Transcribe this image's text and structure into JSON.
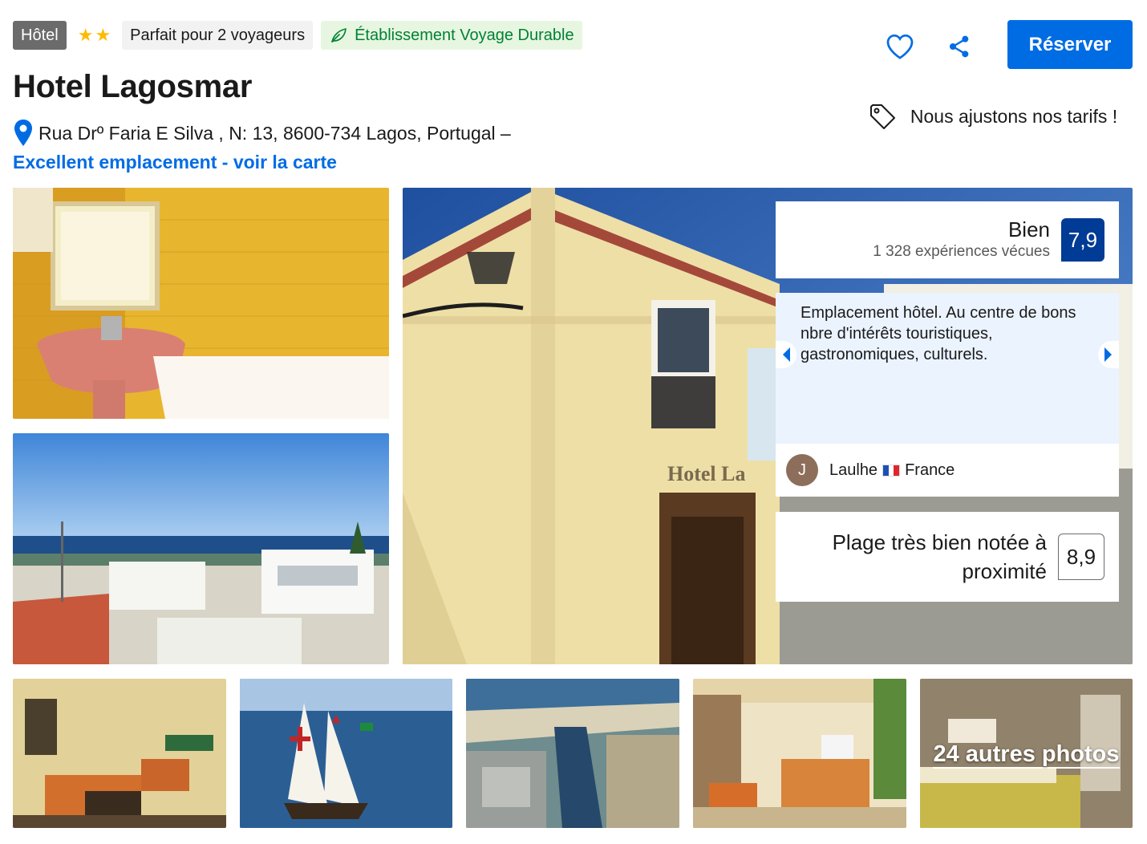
{
  "header": {
    "type_badge": "Hôtel",
    "star_count": 2,
    "stars": [
      "★",
      "★"
    ],
    "travelers_badge": "Parfait pour 2 voyageurs",
    "eco_badge": "Établissement Voyage Durable",
    "title": "Hotel Lagosmar",
    "address": "Rua Drº Faria E Silva , N: 13, 8600-734 Lagos, Portugal –",
    "map_link": "Excellent emplacement - voir la carte"
  },
  "actions": {
    "favorite_icon": "heart-icon",
    "share_icon": "share-icon",
    "reserve_label": "Réserver",
    "price_note": "Nous ajustons nos tarifs !",
    "price_icon": "price-tag-icon"
  },
  "rating": {
    "word": "Bien",
    "count": "1 328 expériences vécues",
    "score": "7,9"
  },
  "review": {
    "text": "Emplacement hôtel. Au centre de bons nbre d'intérêts touristiques, gastronomiques, culturels.",
    "avatar_initial": "J",
    "reviewer_name": "Laulhe",
    "reviewer_country": "France",
    "flag_icon": "france-flag-icon"
  },
  "beach": {
    "text": "Plage très bien notée à proximité",
    "score": "8,9"
  },
  "gallery": {
    "more_photos": "24 autres photos"
  },
  "colors": {
    "brand_blue": "#006ce4",
    "score_blue": "#003b95",
    "eco_green": "#008234",
    "star_yellow": "#febb02"
  }
}
